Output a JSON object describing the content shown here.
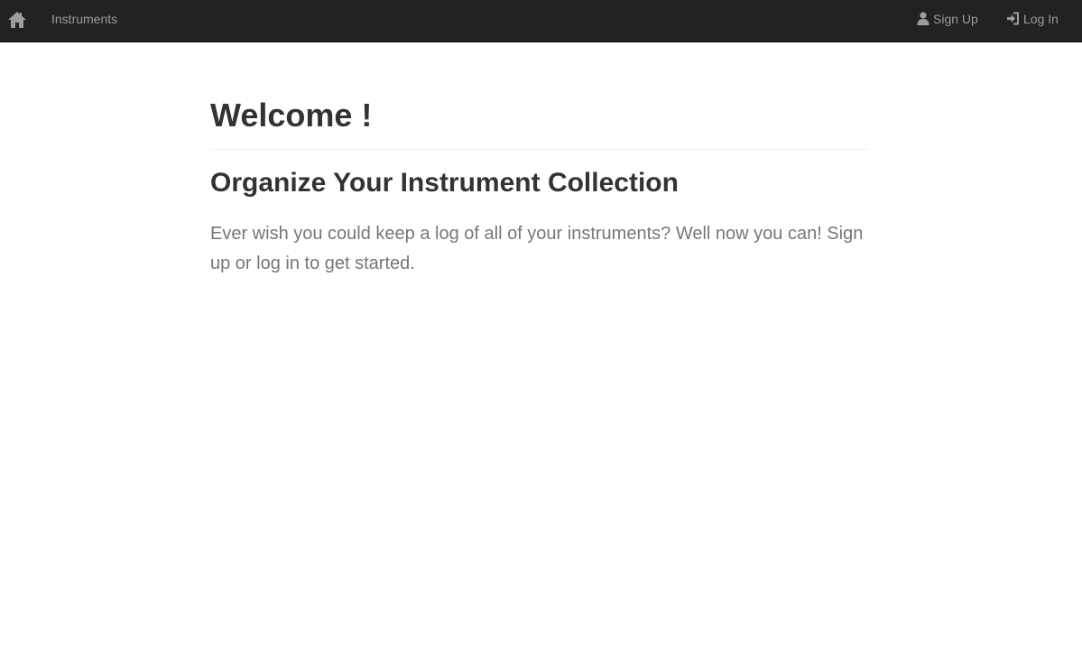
{
  "navbar": {
    "home_icon": "home-icon",
    "brand_label": "Instruments",
    "signup_icon": "user-icon",
    "signup_label": "Sign Up",
    "login_icon": "log-in-icon",
    "login_label": "Log In",
    "background_color": "#222222",
    "link_color": "#9d9d9d"
  },
  "main": {
    "title": "Welcome !",
    "subtitle": "Organize Your Instrument Collection",
    "lead": "Ever wish you could keep a log of all of your instruments? Well now you can! Sign up or log in to get started.",
    "heading_color": "#333333",
    "lead_color": "#777777"
  }
}
